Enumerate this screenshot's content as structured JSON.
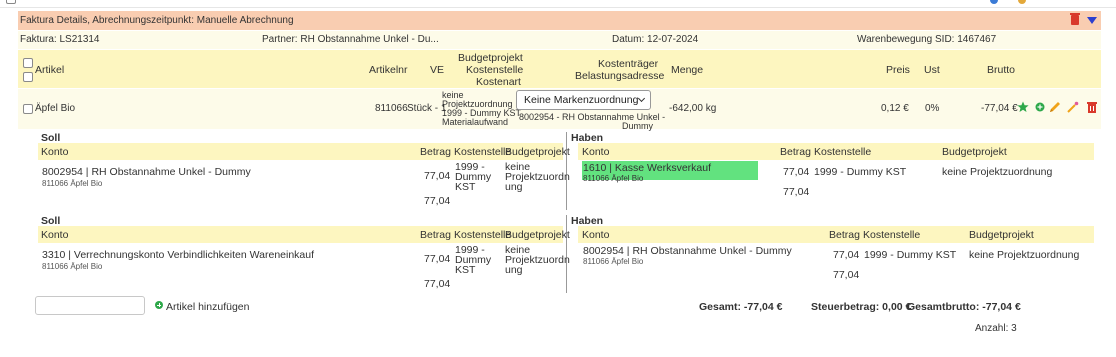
{
  "header": {
    "title": "Faktura Details, Abrechnungszeitpunkt: Manuelle Abrechnung",
    "colors": {
      "header_bg": "#f9cdb1",
      "band_bg": "#fdf6c0",
      "row_bg": "#fdfbe9",
      "highlight": "#62e27f",
      "accent": "#2c3fcf",
      "danger": "#d9392b"
    }
  },
  "info": {
    "faktura": "Faktura: LS21314",
    "partner": "Partner: RH Obstannahme Unkel - Du...",
    "datum": "Datum: 12-07-2024",
    "warenbewegung": "Warenbewegung SID: 1467467"
  },
  "columns": {
    "artikel": "Artikel",
    "artikelnr": "Artikelnr",
    "ve": "VE",
    "budget": "Budgetprojekt",
    "kostenstelle": "Kostenstelle",
    "kostenart": "Kostenart",
    "kostentraeger": "Kostenträger",
    "belastung": "Belastungsadresse",
    "menge": "Menge",
    "preis": "Preis",
    "ust": "Ust",
    "brutto": "Brutto"
  },
  "item": {
    "name": "Äpfel Bio",
    "artikelnr": "811066",
    "ve": "Stück - 1",
    "budget": "keine",
    "budget2": "Projektzuordnung",
    "kostenstelle": "1999 - Dummy KST",
    "kostenart": "Materialaufwand",
    "marke_select": "Keine Markenzuordnung",
    "belastung1": "8002954 - RH Obstannahme Unkel -",
    "belastung2": "Dummy",
    "menge": "-642,00 kg",
    "preis": "0,12 €",
    "ust": "0%",
    "brutto": "-77,04 €",
    "icons": [
      "star-icon",
      "plus-circle-icon",
      "pencil-icon",
      "magic-wand-icon",
      "trash-icon"
    ]
  },
  "booking1": {
    "soll": {
      "title": "Soll",
      "h_konto": "Konto",
      "h_betrag": "Betrag",
      "h_kst": "Kostenstelle",
      "h_bp": "Budgetprojekt",
      "konto": "8002954 | RH Obstannahme Unkel - Dummy",
      "sub": "811066 Äpfel Bio",
      "betrag": "77,04",
      "betrag_sum": "77,04",
      "kst1": "1999 -",
      "kst2": "Dummy",
      "kst3": "KST",
      "bp1": "keine",
      "bp2": "Projektzuordn",
      "bp3": "ung"
    },
    "haben": {
      "title": "Haben",
      "h_konto": "Konto",
      "h_betrag": "Betrag",
      "h_kst": "Kostenstelle",
      "h_bp": "Budgetprojekt",
      "konto": "1610 | Kasse Werksverkauf",
      "sub": "811066 Äpfel Bio",
      "betrag": "77,04",
      "betrag_sum": "77,04",
      "kst": "1999 - Dummy KST",
      "bp": "keine Projektzuordnung"
    }
  },
  "booking2": {
    "soll": {
      "title": "Soll",
      "h_konto": "Konto",
      "h_betrag": "Betrag",
      "h_kst": "Kostenstelle",
      "h_bp": "Budgetprojekt",
      "konto": "3310 | Verrechnungskonto Verbindlichkeiten Wareneinkauf",
      "sub": "811066 Äpfel Bio",
      "betrag": "77,04",
      "betrag_sum": "77,04",
      "kst1": "1999 -",
      "kst2": "Dummy",
      "kst3": "KST",
      "bp1": "keine",
      "bp2": "Projektzuordn",
      "bp3": "ung"
    },
    "haben": {
      "title": "Haben",
      "h_konto": "Konto",
      "h_betrag": "Betrag",
      "h_kst": "Kostenstelle",
      "h_bp": "Budgetprojekt",
      "konto": "8002954 | RH Obstannahme Unkel - Dummy",
      "sub": "811066 Äpfel Bio",
      "betrag": "77,04",
      "betrag_sum": "77,04",
      "kst": "1999 - Dummy KST",
      "bp": "keine Projektzuordnung"
    }
  },
  "footer": {
    "add_label": "Artikel hinzufügen",
    "gesamt": "Gesamt: -77,04 €",
    "steuer": "Steuerbetrag: 0,00 €",
    "gesamtbrutto": "Gesamtbrutto: -77,04 €",
    "anzahl": "Anzahl: 3"
  }
}
